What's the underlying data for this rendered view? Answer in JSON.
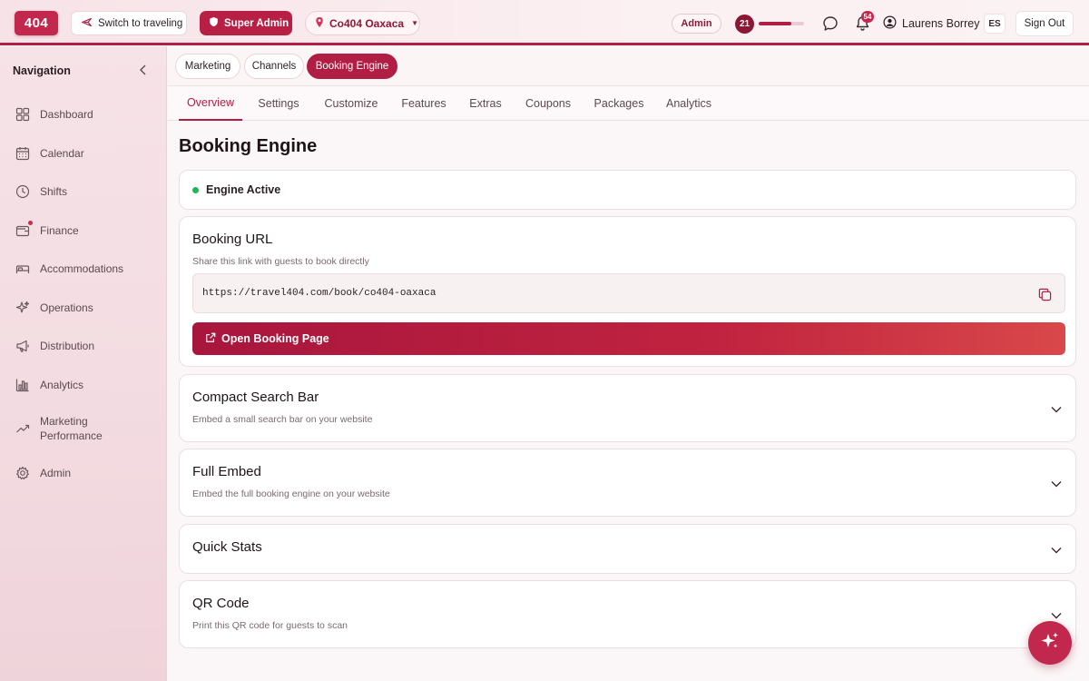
{
  "topbar": {
    "logo": "404",
    "switch_label": "Switch to traveling",
    "super_admin_label": "Super Admin",
    "location_label": "Co404 Oaxaca",
    "role_badge": "Admin",
    "level": "21",
    "level_progress": 0.72,
    "notification_count": "54",
    "user_name": "Laurens Borrey",
    "language": "ES",
    "sign_out": "Sign Out"
  },
  "sidebar": {
    "title": "Navigation",
    "items": [
      {
        "label": "Dashboard",
        "icon": "grid-icon"
      },
      {
        "label": "Calendar",
        "icon": "calendar-icon"
      },
      {
        "label": "Shifts",
        "icon": "clock-icon"
      },
      {
        "label": "Finance",
        "icon": "wallet-icon"
      },
      {
        "label": "Accommodations",
        "icon": "bed-icon"
      },
      {
        "label": "Operations",
        "icon": "sparkles-icon"
      },
      {
        "label": "Distribution",
        "icon": "megaphone-icon"
      },
      {
        "label": "Analytics",
        "icon": "bar-chart-icon"
      },
      {
        "label": "Marketing Performance",
        "icon": "trend-icon"
      },
      {
        "label": "Admin",
        "icon": "gear-icon"
      }
    ]
  },
  "subnav": {
    "chips": [
      "Marketing",
      "Channels",
      "Booking Engine"
    ],
    "active_chip": "Booking Engine"
  },
  "tabs": {
    "items": [
      "Overview",
      "Settings",
      "Customize",
      "Features",
      "Extras",
      "Coupons",
      "Packages",
      "Analytics"
    ],
    "active": "Overview"
  },
  "main": {
    "title": "Booking Engine",
    "status": "Engine Active",
    "booking_url": {
      "title": "Booking URL",
      "subtitle": "Share this link with guests to book directly",
      "url": "https://travel404.com/book/co404-oaxaca",
      "open_label": "Open Booking Page"
    },
    "sections": [
      {
        "title": "Compact Search Bar",
        "subtitle": "Embed a small search bar on your website"
      },
      {
        "title": "Full Embed",
        "subtitle": "Embed the full booking engine on your website"
      },
      {
        "title": "Quick Stats",
        "subtitle": ""
      },
      {
        "title": "QR Code",
        "subtitle": "Print this QR code for guests to scan"
      }
    ]
  },
  "colors": {
    "accent": "#b01e43",
    "status_active": "#22b45a"
  }
}
